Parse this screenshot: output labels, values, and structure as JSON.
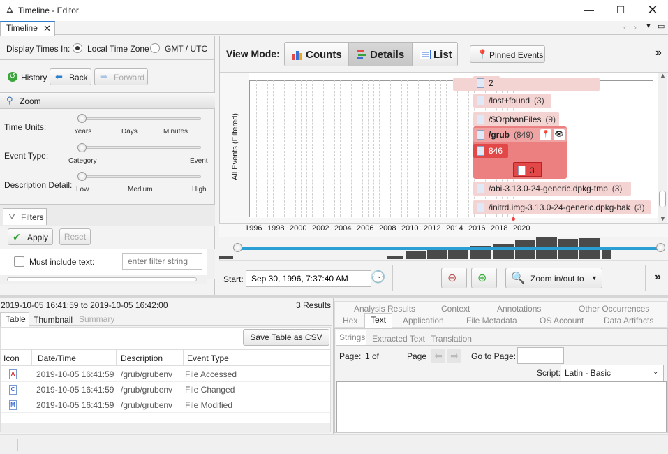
{
  "window": {
    "title": "Timeline - Editor",
    "tab_label": "Timeline"
  },
  "left": {
    "display_times_label": "Display Times In:",
    "tz_local": "Local Time Zone",
    "tz_gmt": "GMT / UTC",
    "history_label": "History",
    "back_label": "Back",
    "forward_label": "Forward",
    "zoom_header": "Zoom",
    "time_units_label": "Time Units:",
    "time_units_ticks": [
      "Years",
      "Days",
      "Minutes"
    ],
    "event_type_label": "Event Type:",
    "event_type_ticks": [
      "Category",
      "Event"
    ],
    "desc_detail_label": "Description Detail:",
    "desc_detail_ticks": [
      "Low",
      "Medium",
      "High"
    ],
    "filters_tab": "Filters",
    "apply_label": "Apply",
    "reset_label": "Reset",
    "must_include_label": "Must include text:",
    "filter_placeholder": "enter filter string"
  },
  "viewmode": {
    "label": "View Mode:",
    "counts": "Counts",
    "details": "Details",
    "list": "List",
    "pinned": "Pinned Events",
    "more": "»"
  },
  "chart": {
    "y_label": "All Events (Filtered)",
    "years": [
      "1996",
      "1998",
      "2000",
      "2002",
      "2004",
      "2006",
      "2008",
      "2010",
      "2012",
      "2014",
      "2016",
      "2018",
      "2020"
    ],
    "events": [
      {
        "name": "2",
        "count": ""
      },
      {
        "name": "/lost+found",
        "count": "(3)"
      },
      {
        "name": "/$OrphanFiles",
        "count": "(9)"
      },
      {
        "name": "/grub",
        "count": "(849)"
      },
      {
        "name": "846",
        "count": ""
      },
      {
        "name": "3",
        "count": ""
      },
      {
        "name": "/abi-3.13.0-24-generic.dpkg-tmp",
        "count": "(3)"
      },
      {
        "name": "/initrd.img-3.13.0-24-generic.dpkg-bak",
        "count": "(3)"
      }
    ],
    "accent": "#2a9fd6",
    "event_color": "#f4d3d3",
    "selected_color": "#ec6b6b"
  },
  "zoombar": {
    "start_label": "Start:",
    "start_value": "Sep 30, 1996, 7:37:40 AM",
    "zoom_inout": "Zoom in/out to"
  },
  "results": {
    "range": "2019-10-05 16:41:59 to 2019-10-05 16:42:00",
    "count": "3  Results",
    "tabs": [
      "Table",
      "Thumbnail",
      "Summary"
    ],
    "save_csv": "Save Table as CSV",
    "columns": [
      "Icon",
      "Date/Time",
      "Description",
      "Event Type"
    ],
    "rows": [
      {
        "icon": "A",
        "date": "2019-10-05 16:41:59",
        "desc": "/grub/grubenv",
        "type": "File Accessed"
      },
      {
        "icon": "C",
        "date": "2019-10-05 16:41:59",
        "desc": "/grub/grubenv",
        "type": "File Changed"
      },
      {
        "icon": "M",
        "date": "2019-10-05 16:41:59",
        "desc": "/grub/grubenv",
        "type": "File Modified"
      }
    ]
  },
  "content": {
    "tabs_row1": [
      "Analysis Results",
      "Context",
      "Annotations",
      "Other Occurrences"
    ],
    "tabs_row2": [
      "Hex",
      "Text",
      "Application",
      "File Metadata",
      "OS Account",
      "Data Artifacts"
    ],
    "subtabs": [
      "Strings",
      "Extracted Text",
      "Translation"
    ],
    "page_label": "Page:",
    "page_value": "1 of",
    "page_nav_label": "Page",
    "goto_label": "Go to Page:",
    "script_label": "Script:",
    "script_value": "Latin - Basic"
  }
}
